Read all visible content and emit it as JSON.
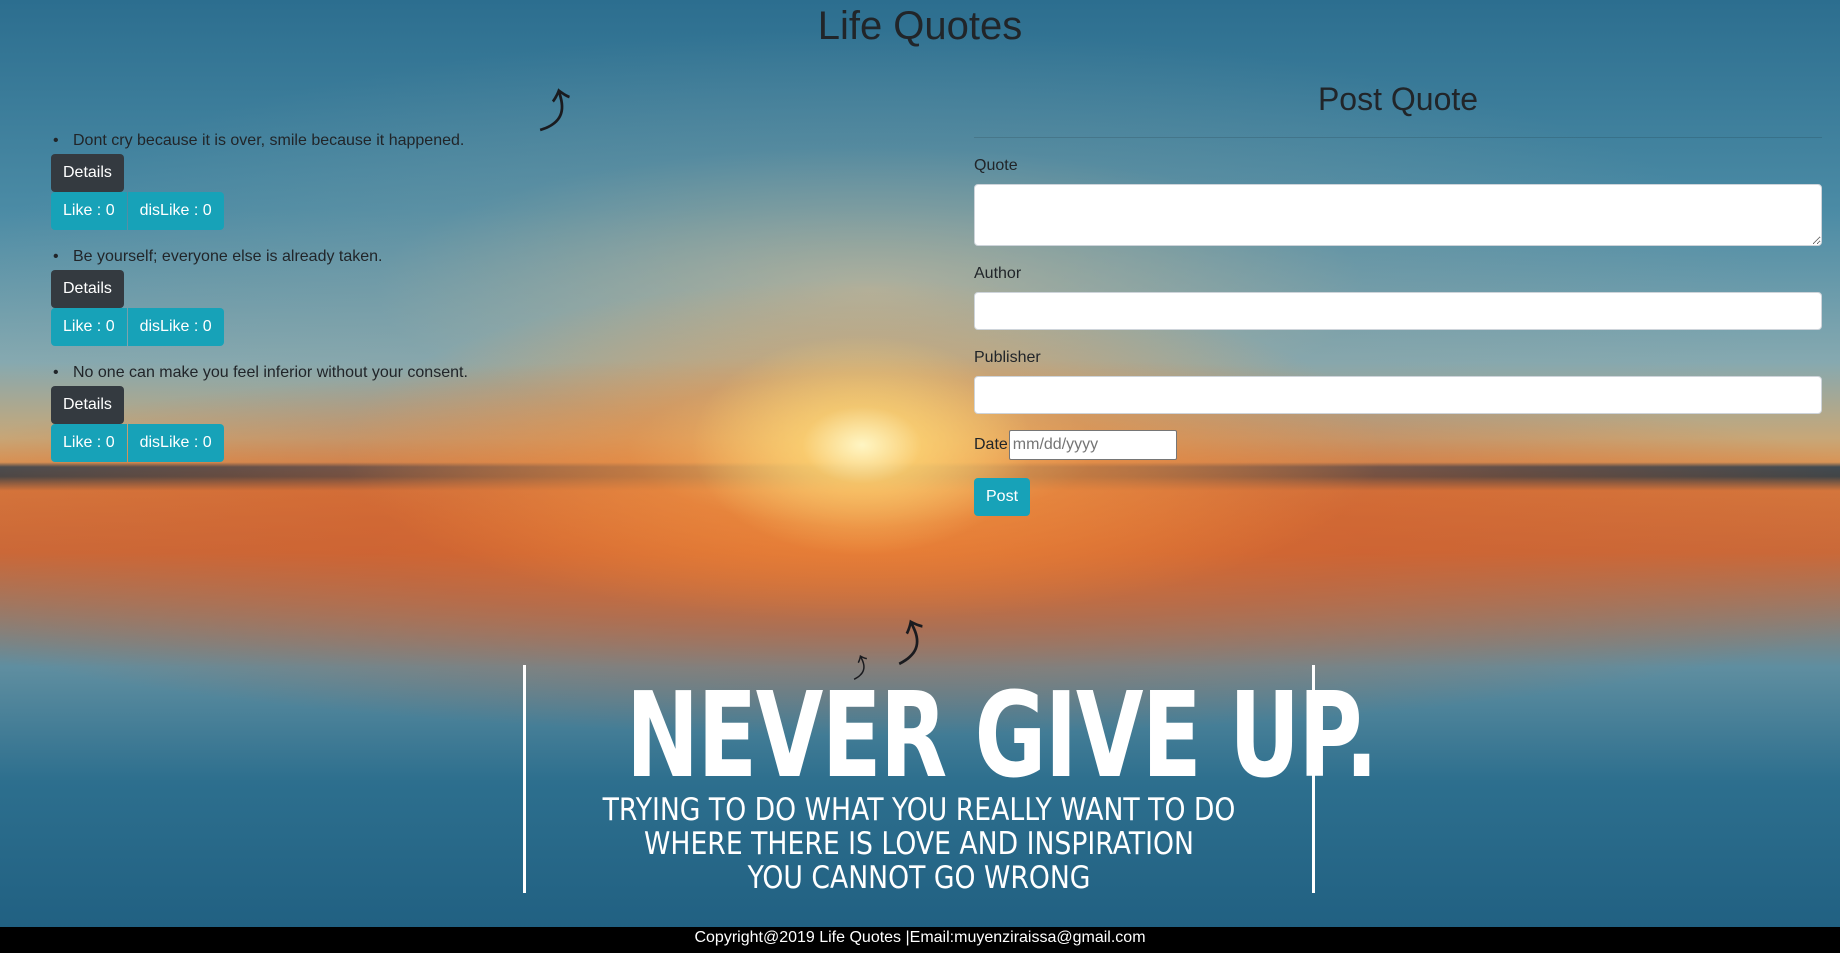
{
  "header": {
    "title": "Life Quotes"
  },
  "quotes": [
    {
      "text": "Dont cry because it is over, smile because it happened.",
      "details_label": "Details",
      "like_label": "Like : 0",
      "dislike_label": "disLike : 0"
    },
    {
      "text": "Be yourself; everyone else is already taken.",
      "details_label": "Details",
      "like_label": "Like : 0",
      "dislike_label": "disLike : 0"
    },
    {
      "text": "No one can make you feel inferior without your consent.",
      "details_label": "Details",
      "like_label": "Like : 0",
      "dislike_label": "disLike : 0"
    }
  ],
  "form": {
    "heading": "Post Quote",
    "quote_label": "Quote",
    "quote_value": "",
    "author_label": "Author",
    "author_value": "",
    "publisher_label": "Publisher",
    "publisher_value": "",
    "date_label": "Date",
    "date_placeholder": "mm/dd/yyyy",
    "post_label": "Post"
  },
  "poster": {
    "headline": "NEVER GIVE UP.",
    "line1": "TRYING TO DO WHAT YOU REALLY WANT TO DO",
    "line2": "WHERE THERE IS LOVE AND INSPIRATION",
    "line3": "YOU CANNOT GO WRONG"
  },
  "footer": {
    "text": "Copyright@2019 Life Quotes |Email:muyenziraissa@gmail.com"
  },
  "colors": {
    "dark_button": "#343a40",
    "info_button": "#17a2b8",
    "footer_bg": "#000000"
  },
  "icons": {
    "bird": "bird-silhouette-icon"
  }
}
